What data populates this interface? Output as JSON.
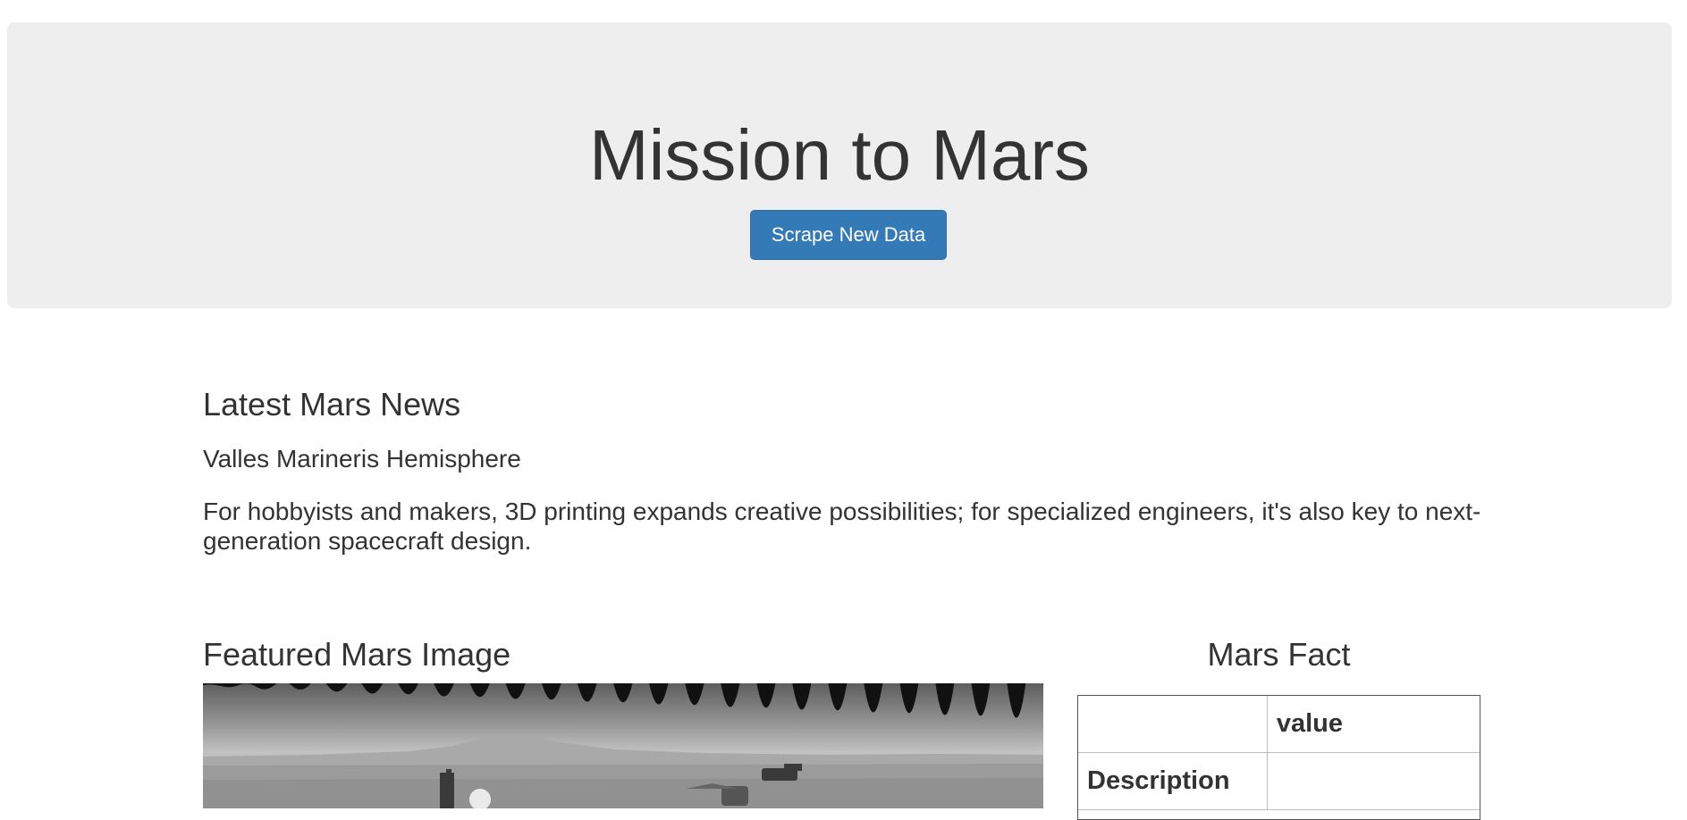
{
  "header": {
    "title": "Mission to Mars",
    "scrape_button_label": "Scrape New Data"
  },
  "news": {
    "heading": "Latest Mars News",
    "title": "Valles Marineris Hemisphere",
    "paragraph": "For hobbyists and makers, 3D printing expands creative possibilities; for specialized engineers, it's also key to next-generation spacecraft design."
  },
  "featured_image": {
    "heading": "Featured Mars Image"
  },
  "facts": {
    "heading": "Mars Fact",
    "columns": [
      "",
      "value"
    ],
    "rows": [
      [
        "Description",
        ""
      ]
    ]
  },
  "colors": {
    "jumbotron_bg": "#eeeeee",
    "button_bg": "#337ab7",
    "text": "#333333"
  }
}
